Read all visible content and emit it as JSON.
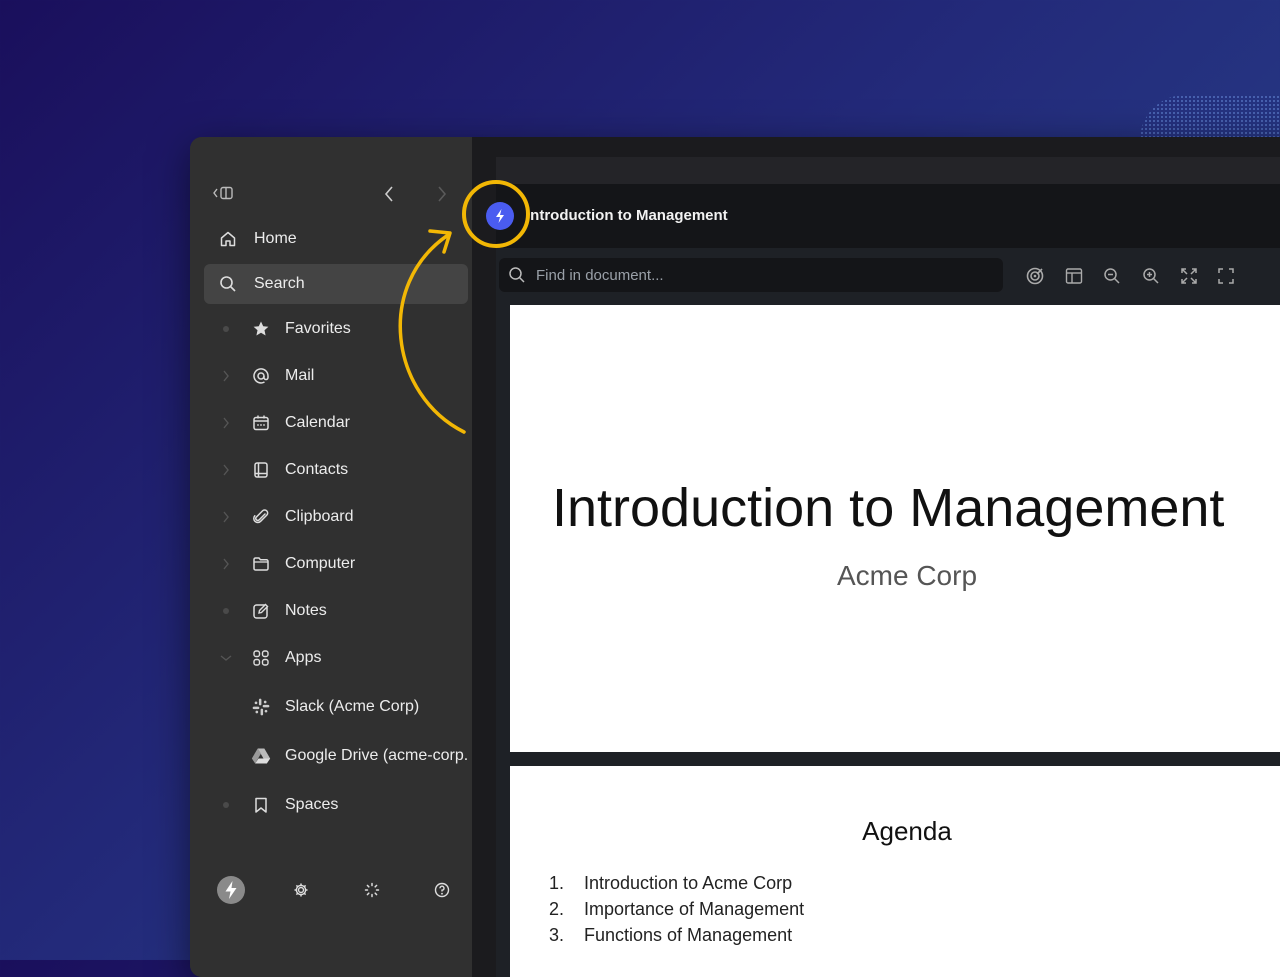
{
  "sidebar": {
    "nav": [
      {
        "label": "Home",
        "icon": "home-icon"
      },
      {
        "label": "Search",
        "icon": "search-icon"
      }
    ],
    "items": [
      {
        "label": "Favorites",
        "icon": "star-icon",
        "lead": "dot"
      },
      {
        "label": "Mail",
        "icon": "at-icon",
        "lead": "chevron"
      },
      {
        "label": "Calendar",
        "icon": "calendar-icon",
        "lead": "chevron"
      },
      {
        "label": "Contacts",
        "icon": "contacts-icon",
        "lead": "chevron"
      },
      {
        "label": "Clipboard",
        "icon": "paperclip-icon",
        "lead": "chevron"
      },
      {
        "label": "Computer",
        "icon": "folder-icon",
        "lead": "chevron"
      },
      {
        "label": "Notes",
        "icon": "notes-icon",
        "lead": "dot"
      },
      {
        "label": "Apps",
        "icon": "apps-grid-icon",
        "lead": "chevron-down"
      },
      {
        "label": "Slack (Acme Corp)",
        "icon": "slack-icon",
        "lead": "none"
      },
      {
        "label": "Google Drive (acme-corp.",
        "icon": "google-drive-icon",
        "lead": "none"
      },
      {
        "label": "Spaces",
        "icon": "bookmark-icon",
        "lead": "dot"
      }
    ]
  },
  "panel": {
    "title": "Introduction to Management",
    "search_placeholder": "Find in document..."
  },
  "document": {
    "title": "Introduction to Management",
    "subtitle": "Acme Corp",
    "agenda_heading": "Agenda",
    "agenda": [
      {
        "num": "1.",
        "text": "Introduction to Acme Corp"
      },
      {
        "num": "2.",
        "text": "Importance of Management"
      },
      {
        "num": "3.",
        "text": "Functions of Management"
      }
    ]
  },
  "colors": {
    "accent": "#4a5cf0",
    "highlight": "#f2b705"
  }
}
